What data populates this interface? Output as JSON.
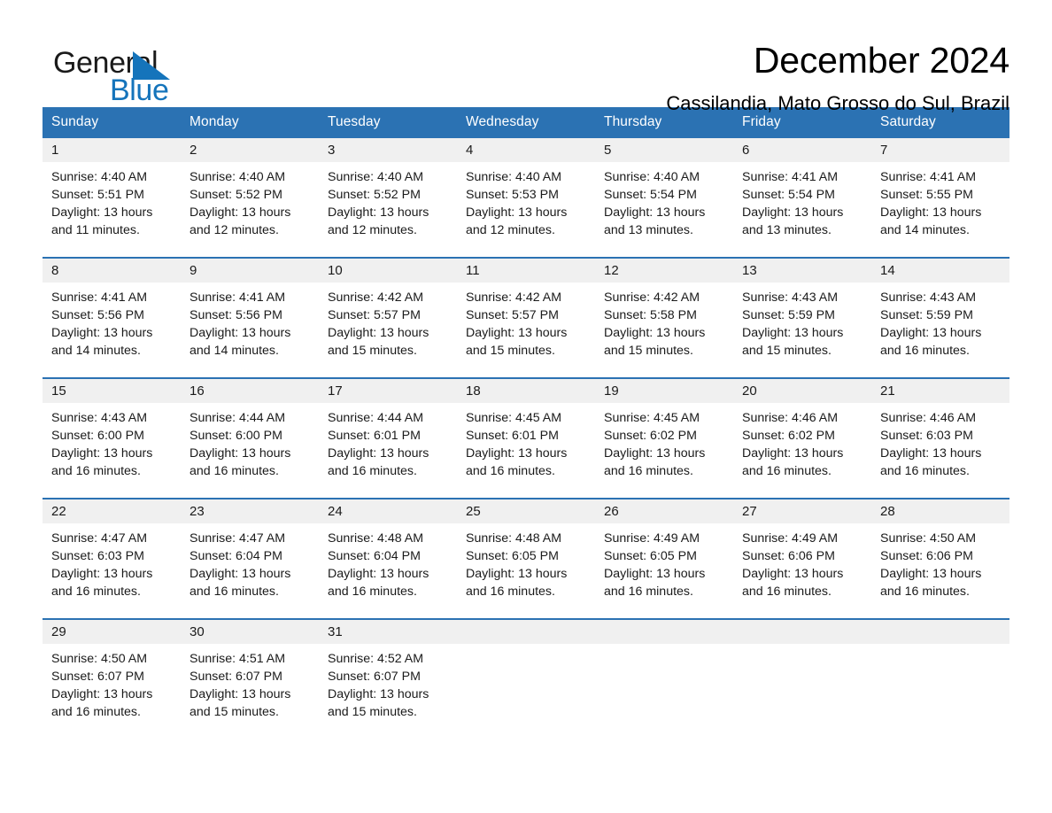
{
  "brand": {
    "name_top": "General",
    "name_bottom": "Blue"
  },
  "header": {
    "title": "December 2024",
    "subtitle": "Cassilandia, Mato Grosso do Sul, Brazil"
  },
  "colors": {
    "header_blue": "#2b72b3",
    "brand_blue": "#1574bb",
    "daynum_background": "#f0f0f0"
  },
  "calendar": {
    "weekday_headers": [
      "Sunday",
      "Monday",
      "Tuesday",
      "Wednesday",
      "Thursday",
      "Friday",
      "Saturday"
    ],
    "weeks": [
      {
        "days": [
          {
            "date": "1",
            "lines": [
              "Sunrise: 4:40 AM",
              "Sunset: 5:51 PM",
              "Daylight: 13 hours",
              "and 11 minutes."
            ]
          },
          {
            "date": "2",
            "lines": [
              "Sunrise: 4:40 AM",
              "Sunset: 5:52 PM",
              "Daylight: 13 hours",
              "and 12 minutes."
            ]
          },
          {
            "date": "3",
            "lines": [
              "Sunrise: 4:40 AM",
              "Sunset: 5:52 PM",
              "Daylight: 13 hours",
              "and 12 minutes."
            ]
          },
          {
            "date": "4",
            "lines": [
              "Sunrise: 4:40 AM",
              "Sunset: 5:53 PM",
              "Daylight: 13 hours",
              "and 12 minutes."
            ]
          },
          {
            "date": "5",
            "lines": [
              "Sunrise: 4:40 AM",
              "Sunset: 5:54 PM",
              "Daylight: 13 hours",
              "and 13 minutes."
            ]
          },
          {
            "date": "6",
            "lines": [
              "Sunrise: 4:41 AM",
              "Sunset: 5:54 PM",
              "Daylight: 13 hours",
              "and 13 minutes."
            ]
          },
          {
            "date": "7",
            "lines": [
              "Sunrise: 4:41 AM",
              "Sunset: 5:55 PM",
              "Daylight: 13 hours",
              "and 14 minutes."
            ]
          }
        ]
      },
      {
        "days": [
          {
            "date": "8",
            "lines": [
              "Sunrise: 4:41 AM",
              "Sunset: 5:56 PM",
              "Daylight: 13 hours",
              "and 14 minutes."
            ]
          },
          {
            "date": "9",
            "lines": [
              "Sunrise: 4:41 AM",
              "Sunset: 5:56 PM",
              "Daylight: 13 hours",
              "and 14 minutes."
            ]
          },
          {
            "date": "10",
            "lines": [
              "Sunrise: 4:42 AM",
              "Sunset: 5:57 PM",
              "Daylight: 13 hours",
              "and 15 minutes."
            ]
          },
          {
            "date": "11",
            "lines": [
              "Sunrise: 4:42 AM",
              "Sunset: 5:57 PM",
              "Daylight: 13 hours",
              "and 15 minutes."
            ]
          },
          {
            "date": "12",
            "lines": [
              "Sunrise: 4:42 AM",
              "Sunset: 5:58 PM",
              "Daylight: 13 hours",
              "and 15 minutes."
            ]
          },
          {
            "date": "13",
            "lines": [
              "Sunrise: 4:43 AM",
              "Sunset: 5:59 PM",
              "Daylight: 13 hours",
              "and 15 minutes."
            ]
          },
          {
            "date": "14",
            "lines": [
              "Sunrise: 4:43 AM",
              "Sunset: 5:59 PM",
              "Daylight: 13 hours",
              "and 16 minutes."
            ]
          }
        ]
      },
      {
        "days": [
          {
            "date": "15",
            "lines": [
              "Sunrise: 4:43 AM",
              "Sunset: 6:00 PM",
              "Daylight: 13 hours",
              "and 16 minutes."
            ]
          },
          {
            "date": "16",
            "lines": [
              "Sunrise: 4:44 AM",
              "Sunset: 6:00 PM",
              "Daylight: 13 hours",
              "and 16 minutes."
            ]
          },
          {
            "date": "17",
            "lines": [
              "Sunrise: 4:44 AM",
              "Sunset: 6:01 PM",
              "Daylight: 13 hours",
              "and 16 minutes."
            ]
          },
          {
            "date": "18",
            "lines": [
              "Sunrise: 4:45 AM",
              "Sunset: 6:01 PM",
              "Daylight: 13 hours",
              "and 16 minutes."
            ]
          },
          {
            "date": "19",
            "lines": [
              "Sunrise: 4:45 AM",
              "Sunset: 6:02 PM",
              "Daylight: 13 hours",
              "and 16 minutes."
            ]
          },
          {
            "date": "20",
            "lines": [
              "Sunrise: 4:46 AM",
              "Sunset: 6:02 PM",
              "Daylight: 13 hours",
              "and 16 minutes."
            ]
          },
          {
            "date": "21",
            "lines": [
              "Sunrise: 4:46 AM",
              "Sunset: 6:03 PM",
              "Daylight: 13 hours",
              "and 16 minutes."
            ]
          }
        ]
      },
      {
        "days": [
          {
            "date": "22",
            "lines": [
              "Sunrise: 4:47 AM",
              "Sunset: 6:03 PM",
              "Daylight: 13 hours",
              "and 16 minutes."
            ]
          },
          {
            "date": "23",
            "lines": [
              "Sunrise: 4:47 AM",
              "Sunset: 6:04 PM",
              "Daylight: 13 hours",
              "and 16 minutes."
            ]
          },
          {
            "date": "24",
            "lines": [
              "Sunrise: 4:48 AM",
              "Sunset: 6:04 PM",
              "Daylight: 13 hours",
              "and 16 minutes."
            ]
          },
          {
            "date": "25",
            "lines": [
              "Sunrise: 4:48 AM",
              "Sunset: 6:05 PM",
              "Daylight: 13 hours",
              "and 16 minutes."
            ]
          },
          {
            "date": "26",
            "lines": [
              "Sunrise: 4:49 AM",
              "Sunset: 6:05 PM",
              "Daylight: 13 hours",
              "and 16 minutes."
            ]
          },
          {
            "date": "27",
            "lines": [
              "Sunrise: 4:49 AM",
              "Sunset: 6:06 PM",
              "Daylight: 13 hours",
              "and 16 minutes."
            ]
          },
          {
            "date": "28",
            "lines": [
              "Sunrise: 4:50 AM",
              "Sunset: 6:06 PM",
              "Daylight: 13 hours",
              "and 16 minutes."
            ]
          }
        ]
      },
      {
        "days": [
          {
            "date": "29",
            "lines": [
              "Sunrise: 4:50 AM",
              "Sunset: 6:07 PM",
              "Daylight: 13 hours",
              "and 16 minutes."
            ]
          },
          {
            "date": "30",
            "lines": [
              "Sunrise: 4:51 AM",
              "Sunset: 6:07 PM",
              "Daylight: 13 hours",
              "and 15 minutes."
            ]
          },
          {
            "date": "31",
            "lines": [
              "Sunrise: 4:52 AM",
              "Sunset: 6:07 PM",
              "Daylight: 13 hours",
              "and 15 minutes."
            ]
          },
          {
            "date": "",
            "lines": []
          },
          {
            "date": "",
            "lines": []
          },
          {
            "date": "",
            "lines": []
          },
          {
            "date": "",
            "lines": []
          }
        ]
      }
    ]
  }
}
